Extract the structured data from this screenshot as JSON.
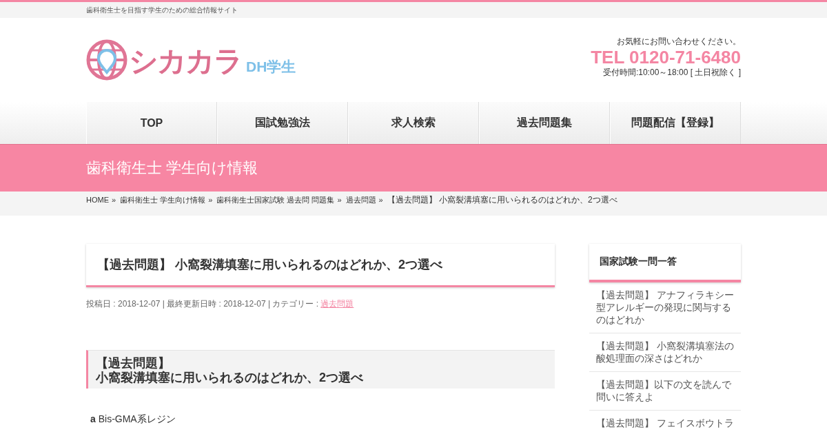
{
  "tagline": "歯科衛生士を目指す学生のための総合情報サイト",
  "logo": {
    "name": "シカカラ",
    "sub": "DH学生"
  },
  "contact": {
    "note": "お気軽にお問い合わせください。",
    "tel": "TEL 0120-71-6480",
    "hours": "受付時間:10:00～18:00 [ 土日祝除く ]"
  },
  "nav": [
    {
      "label": "TOP"
    },
    {
      "label": "国試勉強法"
    },
    {
      "label": "求人検索"
    },
    {
      "label": "過去問題集"
    },
    {
      "label": "問題配信【登録】"
    }
  ],
  "category_title": "歯科衛生士 学生向け情報",
  "breadcrumb": [
    {
      "label": "HOME",
      "kind": "link",
      "separator": "»"
    },
    {
      "label": "歯科衛生士 学生向け情報",
      "kind": "link",
      "separator": "»"
    },
    {
      "label": "歯科衛生士国家試験 過去問 問題集",
      "kind": "link",
      "separator": "»"
    },
    {
      "label": "過去問題",
      "kind": "link",
      "separator": "»"
    },
    {
      "label": "【過去問題】 小窩裂溝填塞に用いられるのはどれか、2つ選べ",
      "kind": "current"
    }
  ],
  "article": {
    "title": "【過去問題】 小窩裂溝填塞に用いられるのはどれか、2つ選べ",
    "meta": "投稿日 : 2018-12-07 | 最終更新日時 : 2018-12-07 | カテゴリー : ",
    "category_link": "過去問題",
    "heading": [
      "【過去問題】",
      "小窩裂溝填塞に用いられるのはどれか、2つ選べ"
    ],
    "options": [
      {
        "letter": "a",
        "text": "Bis-GMA系レジン"
      }
    ]
  },
  "sidebar": {
    "title": "国家試験一問一答",
    "items": [
      "【過去問題】 アナフィラキシー型アレルギーの発現に関与するのはどれか",
      "【過去問題】 小窩裂溝填塞法の酸処理面の深さはどれか",
      "【過去問題】以下の文を読んで問いに答えよ",
      "【過去問題】 フェイスボウトラ"
    ]
  }
}
